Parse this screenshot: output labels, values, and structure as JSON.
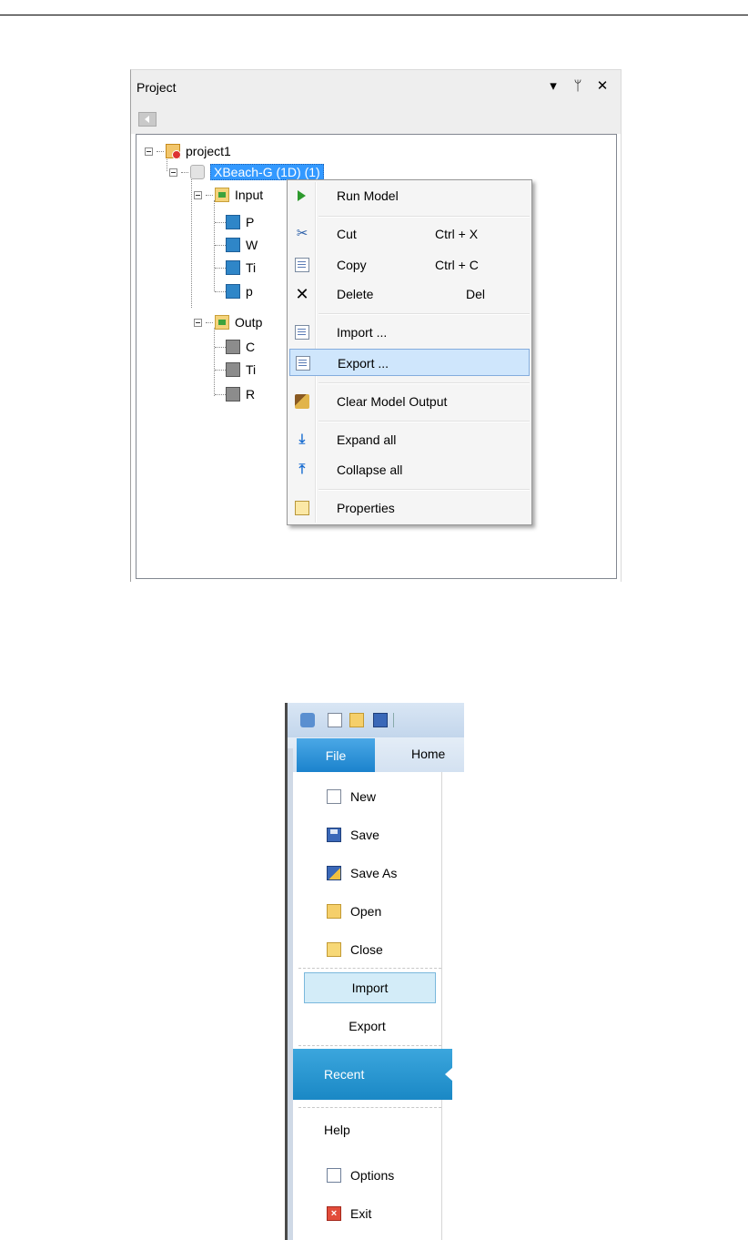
{
  "project_panel": {
    "title": "Project",
    "dropdown_glyph": "▾",
    "pin_glyph": "ᛘ",
    "close_glyph": "✕",
    "tree": {
      "root_label": "project1",
      "model_label": "XBeach-G (1D) (1)",
      "input_label": "Input",
      "input_children": [
        "P",
        "W",
        "Ti",
        "p"
      ],
      "output_label": "Outp",
      "output_children": [
        "C",
        "Ti",
        "R"
      ]
    }
  },
  "context_menu": {
    "items": [
      {
        "label": "Run Model",
        "shortcut": "",
        "icon": "play-icon"
      },
      {
        "label": "Cut",
        "shortcut": "Ctrl + X",
        "icon": "scissors-icon"
      },
      {
        "label": "Copy",
        "shortcut": "Ctrl + C",
        "icon": "copy-icon"
      },
      {
        "label": "Delete",
        "shortcut": "Del",
        "icon": "delete-icon"
      },
      {
        "label": "Import ...",
        "shortcut": "",
        "icon": "import-icon"
      },
      {
        "label": "Export ...",
        "shortcut": "",
        "icon": "export-icon"
      },
      {
        "label": "Clear Model Output",
        "shortcut": "",
        "icon": "broom-icon"
      },
      {
        "label": "Expand all",
        "shortcut": "",
        "icon": "expand-all-icon"
      },
      {
        "label": "Collapse all",
        "shortcut": "",
        "icon": "collapse-all-icon"
      },
      {
        "label": "Properties",
        "shortcut": "",
        "icon": "properties-icon"
      }
    ],
    "highlighted": "Export ..."
  },
  "file_menu": {
    "tabs": {
      "file": "File",
      "home": "Home"
    },
    "items": {
      "new": "New",
      "save": "Save",
      "save_as": "Save As",
      "open": "Open",
      "close": "Close",
      "import": "Import",
      "export": "Export",
      "recent": "Recent",
      "help": "Help",
      "options": "Options",
      "exit": "Exit"
    },
    "accent_color": "#1a88c5"
  }
}
